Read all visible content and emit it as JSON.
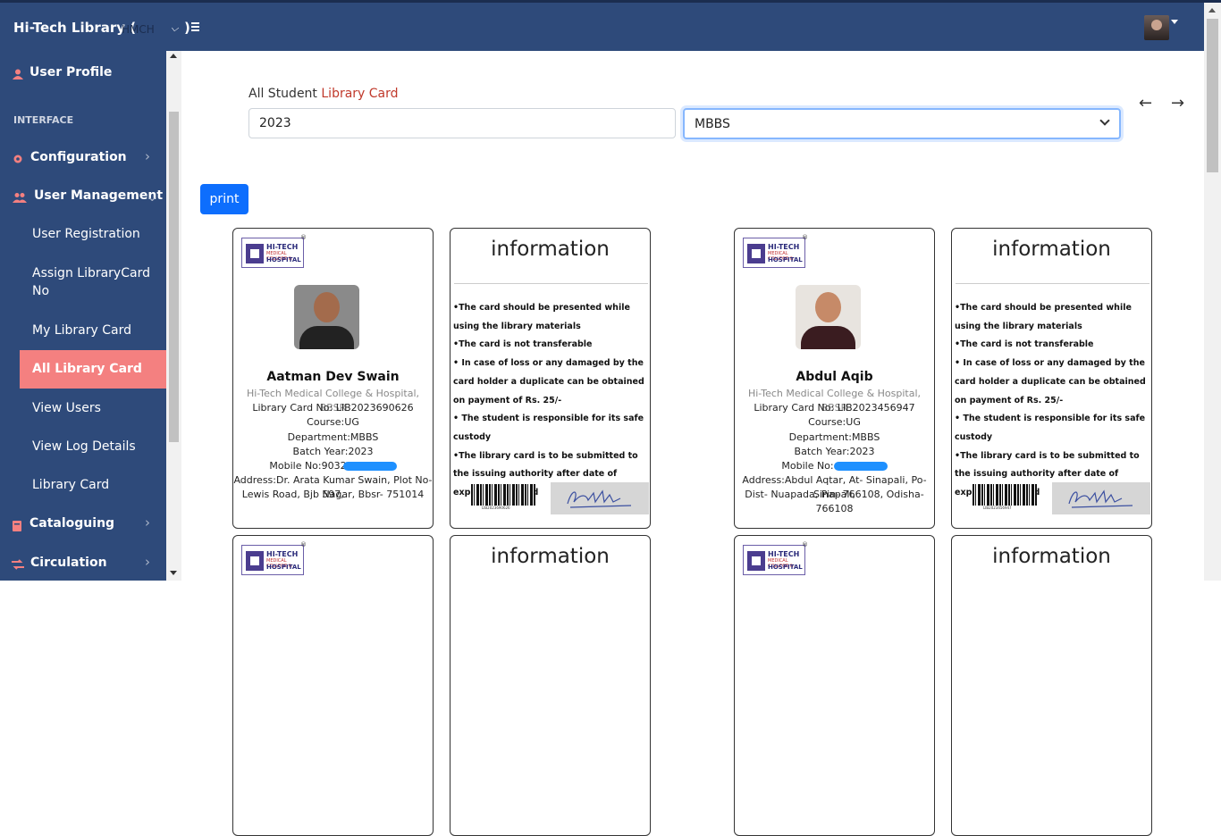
{
  "header": {
    "brand": "Hi-Tech Library (",
    "branch_value": "HMCH",
    "close_paren": ")"
  },
  "sidebar": {
    "user_profile": "User Profile",
    "section_interface": "INTERFACE",
    "configuration": "Configuration",
    "user_management": "User Management",
    "sub_items": {
      "user_registration": "User Registration",
      "assign_library_card": "Assign LibraryCard No",
      "my_library_card": "My Library Card",
      "all_library_card": "All Library Card",
      "view_users": "View Users",
      "view_log_details": "View Log Details",
      "library_card": "Library Card"
    },
    "cataloguing": "Cataloguing",
    "circulation": "Circulation"
  },
  "main": {
    "title_prefix": "All Student",
    "title_accent": "Library Card",
    "year_value": "2023",
    "course_value": "MBBS",
    "print_label": "print",
    "back_arrow": "←",
    "forward_arrow": "→"
  },
  "logo": {
    "line1": "HI-TECH",
    "line2": "MEDICAL COLLEGE &",
    "line3": "HOSPITAL",
    "reg": "®"
  },
  "info": {
    "heading": "information",
    "rules": [
      "•The card should be presented while using the library materials",
      "•The card is not transferable",
      "• In case of loss or any damaged by the card holder a duplicate can be obtained on payment of Rs. 25/-",
      "• The student is responsible for its safe custody",
      "•The library card is to be submitted to the issuing authority after date of expiry of the card"
    ]
  },
  "cards": [
    {
      "name": "Aatman Dev Swain",
      "college": "Hi-Tech Medical College & Hospital, BBSR",
      "card_no": "Library Card No: LIB2023690626",
      "course": "Course:UG",
      "department": "Department:MBBS",
      "batch": "Batch Year:2023",
      "mobile_label": "Mobile No:",
      "mobile_visible": "9032",
      "address1": "Address:Dr. Arata Kumar Swain, Plot No-597,",
      "address2": "Lewis Road, Bjb Nagar, Bbsr- 751014",
      "barcode_num": "LIB2023690626",
      "photo_bg": "#8a8a8a",
      "face_color": "#a36b4c",
      "shirt_color": "#222222"
    },
    {
      "name": "Abdul Aqib",
      "college": "Hi-Tech Medical College & Hospital, BBSR",
      "card_no": "Library Card No: LIB2023456947",
      "course": "Course:UG",
      "department": "Department:MBBS",
      "batch": "Batch Year:2023",
      "mobile_label": "Mobile No:",
      "mobile_visible": "",
      "address1": "Address:Abdul Aqtar, At- Sinapali, Po- Sinapali,",
      "address2": "Dist- Nuapada, Pin- 766108, Odisha- 766108",
      "barcode_num": "LIB2023456947",
      "photo_bg": "#e8e4df",
      "face_color": "#c68a68",
      "shirt_color": "#3a1c20"
    }
  ],
  "colors": {
    "sidebar_bg": "#2e4a7a",
    "active_item": "#f48080",
    "accent_text": "#c0392b",
    "print_button": "#0d6efd"
  }
}
